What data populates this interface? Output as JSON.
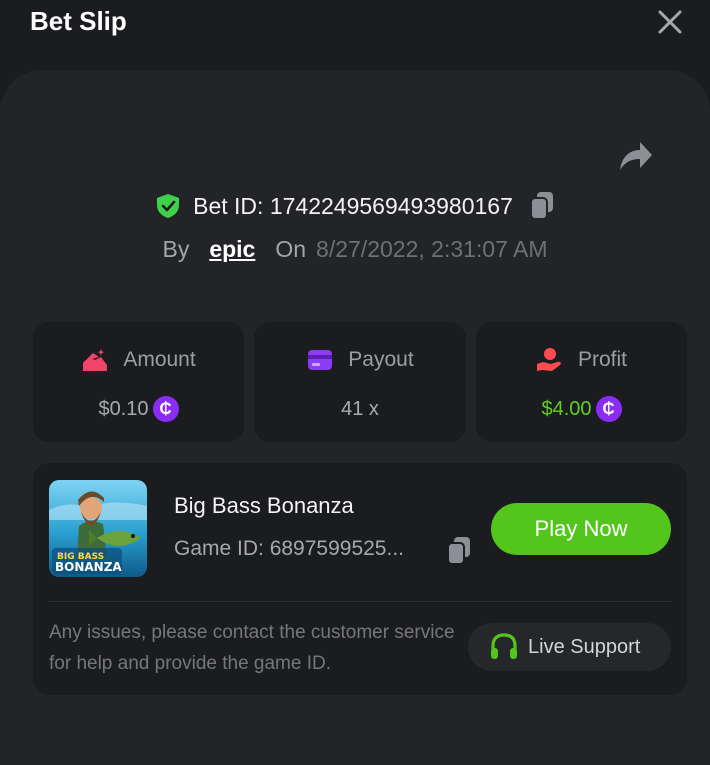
{
  "header": {
    "title": "Bet Slip"
  },
  "bet": {
    "id_text": "Bet ID: 1742249569493980167",
    "by_label": "By",
    "username": "epic",
    "on_label": "On",
    "datetime": "8/27/2022, 2:31:07 AM"
  },
  "stats": {
    "amount": {
      "label": "Amount",
      "value": "$0.10",
      "icon": "bag-icon"
    },
    "payout": {
      "label": "Payout",
      "value": "41 x",
      "icon": "card-icon"
    },
    "profit": {
      "label": "Profit",
      "value": "$4.00",
      "icon": "money-hand-icon"
    }
  },
  "coin_symbol": "₵",
  "game": {
    "name": "Big Bass Bonanza",
    "id_text": "Game ID: 6897599525...",
    "play_label": "Play Now",
    "thumb_line1": "BIG BASS",
    "thumb_line2": "BONANZA",
    "help_text": "Any issues, please contact the customer service for help and provide the game ID.",
    "support_label": "Live Support"
  },
  "colors": {
    "accent_green": "#53c51c",
    "coin_purple": "#8b2cf5",
    "shield_green": "#3fd14b",
    "amount_icon": "#f0446a",
    "payout_icon": "#8b3cf5",
    "profit_icon": "#ff4b4b"
  }
}
